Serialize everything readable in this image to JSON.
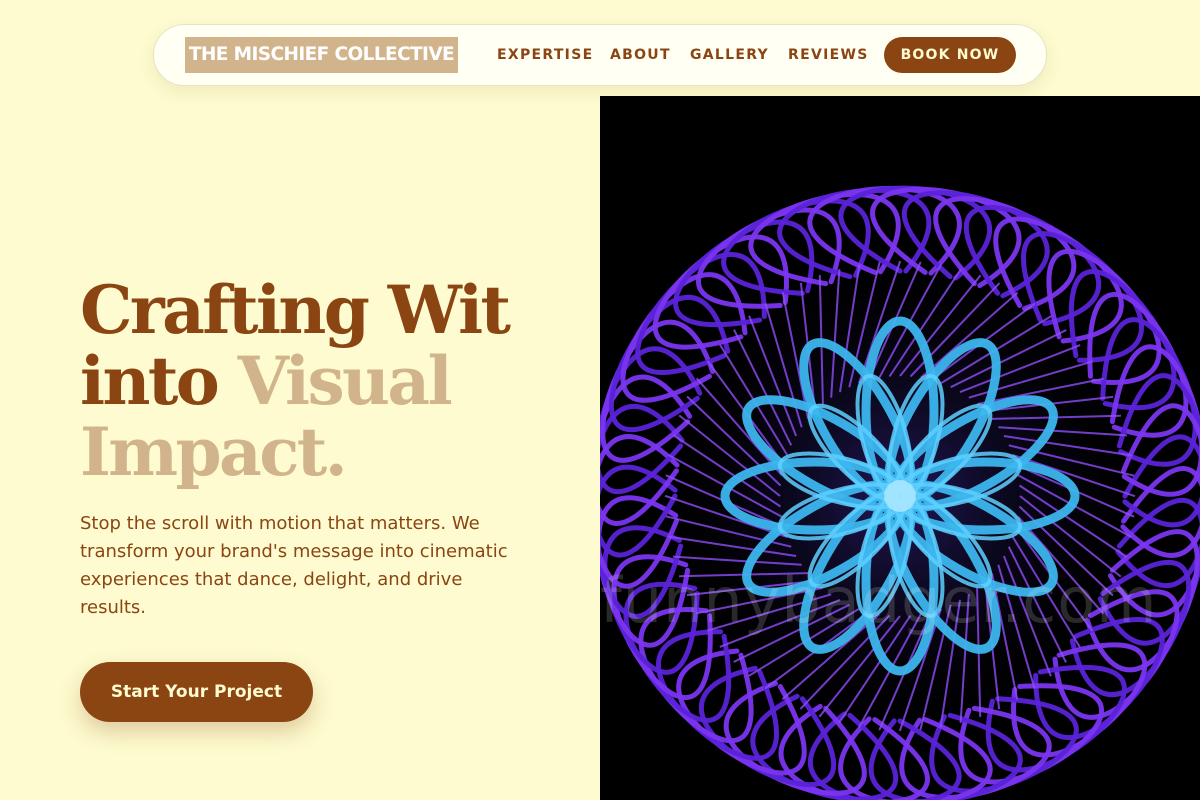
{
  "brand": {
    "name": "THE MISCHIEF COLLECTIVE",
    "primary_color": "#8b4513",
    "accent_color": "#d2b48c",
    "background_color": "#fdfbcf"
  },
  "nav": {
    "links": [
      "EXPERTISE",
      "ABOUT",
      "GALLERY",
      "REVIEWS"
    ],
    "book_label": "BOOK NOW"
  },
  "hero": {
    "headline_line1": "Crafting Wit",
    "headline_line2_a": "into",
    "headline_line2_b": "Visual",
    "headline_line3": "Impact.",
    "body": "Stop the scroll with motion that matters. We transform your brand's message into cinematic experiences that dance, delight, and drive results.",
    "cta_label": "Start Your Project"
  },
  "artwork": {
    "watermark": "funnybadger.com",
    "description_icon": "spirograph-image"
  }
}
